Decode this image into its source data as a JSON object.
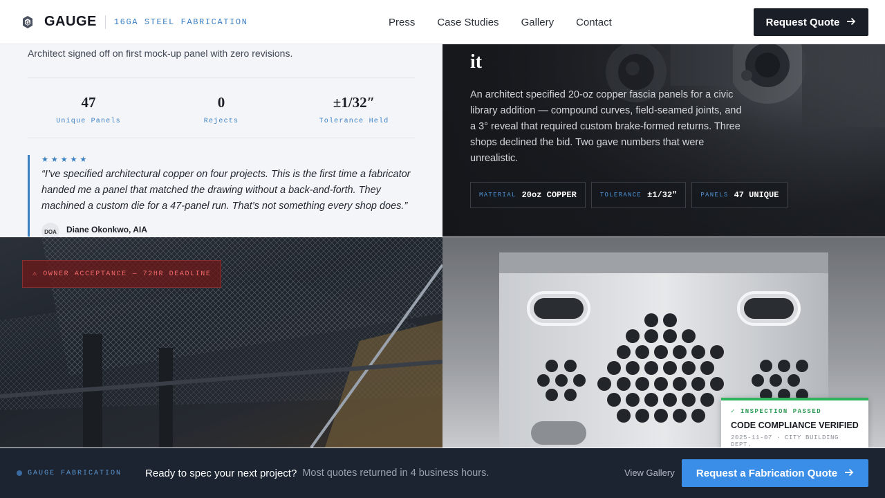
{
  "header": {
    "brand": "GAUGE",
    "tagline": "16GA STEEL FABRICATION",
    "nav": [
      "Press",
      "Case Studies",
      "Gallery",
      "Contact"
    ],
    "cta": "Request Quote"
  },
  "case": {
    "summary_line": "Architect signed off on first mock-up panel with zero revisions.",
    "stats": [
      {
        "value": "47",
        "label": "Unique Panels"
      },
      {
        "value": "0",
        "label": "Rejects"
      },
      {
        "value": "±1/32″",
        "label": "Tolerance Held"
      }
    ],
    "rating_stars": "★★★★★",
    "quote": "“I’ve specified architectural copper on four projects. This is the first time a fabricator handed me a panel that matched the drawing without a back-and-forth. They machined a custom die for a 47-panel run. That’s not something every shop does.”",
    "author_initials": "DOA",
    "author_name": "Diane Okonkwo, AIA"
  },
  "feature": {
    "title_fragment": "it",
    "body": "An architect specified 20-oz copper fascia panels for a civic library addition — compound curves, field-seamed joints, and a 3° reveal that required custom brake-formed returns. Three shops declined the bid. Two gave numbers that were unrealistic.",
    "chips": [
      {
        "key": "MATERIAL",
        "value": "20oz COPPER"
      },
      {
        "key": "TOLERANCE",
        "value": "±1/32\""
      },
      {
        "key": "PANELS",
        "value": "47 UNIQUE"
      }
    ]
  },
  "gallery": {
    "alert": "⚠ OWNER ACCEPTANCE — 72HR DEADLINE",
    "inspection_tag": "✓ INSPECTION PASSED",
    "inspection_title": "CODE COMPLIANCE VERIFIED",
    "inspection_meta": "2025-11-07 · CITY BUILDING DEPT."
  },
  "footer": {
    "brand": "GAUGE FABRICATION",
    "headline": "Ready to spec your next project?",
    "subline": "Most quotes returned in 4 business hours.",
    "gallery_link": "View Gallery",
    "cta": "Request a Fabrication Quote"
  },
  "colors": {
    "accent": "#3a7fc2",
    "cta_blue": "#3b8ee8",
    "dark": "#1a1e27",
    "success": "#2fb35e",
    "alert_red": "#f16a6a"
  }
}
